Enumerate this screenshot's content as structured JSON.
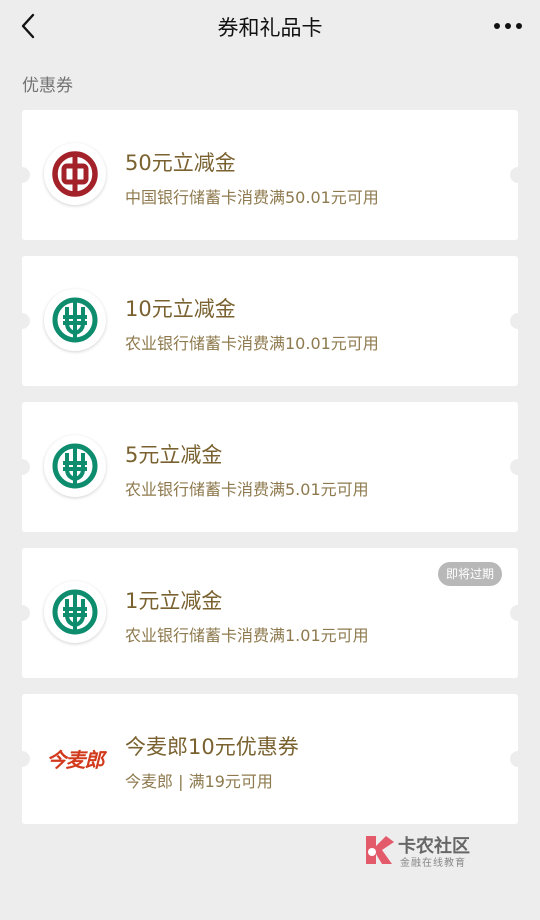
{
  "header": {
    "title": "券和礼品卡",
    "back_icon": "chevron-left-icon",
    "more_icon": "more-horizontal-icon"
  },
  "section": {
    "label": "优惠券"
  },
  "coupons": [
    {
      "title": "50元立减金",
      "subtitle": "中国银行储蓄卡消费满50.01元可用",
      "logo": "bank-of-china-logo",
      "badge": ""
    },
    {
      "title": "10元立减金",
      "subtitle": "农业银行储蓄卡消费满10.01元可用",
      "logo": "agricultural-bank-logo",
      "badge": ""
    },
    {
      "title": "5元立减金",
      "subtitle": "农业银行储蓄卡消费满5.01元可用",
      "logo": "agricultural-bank-logo",
      "badge": ""
    },
    {
      "title": "1元立减金",
      "subtitle": "农业银行储蓄卡消费满1.01元可用",
      "logo": "agricultural-bank-logo",
      "badge": "即将过期"
    },
    {
      "title": "今麦郎10元优惠券",
      "subtitle": "今麦郎 | 满19元可用",
      "logo": "jinmailang-logo",
      "logo_text": "今麦郎",
      "badge": ""
    }
  ],
  "watermark": {
    "title": "卡农社区",
    "subtitle": "金融在线教育"
  },
  "colors": {
    "background": "#ededed",
    "card": "#ffffff",
    "title_gold": "#7a6230",
    "subtitle_gold": "#8e7a4e",
    "boc_red": "#a3222a",
    "abc_green": "#0e8c6e",
    "jml_red": "#d23a1e",
    "badge_gray": "#b8b8b8"
  }
}
